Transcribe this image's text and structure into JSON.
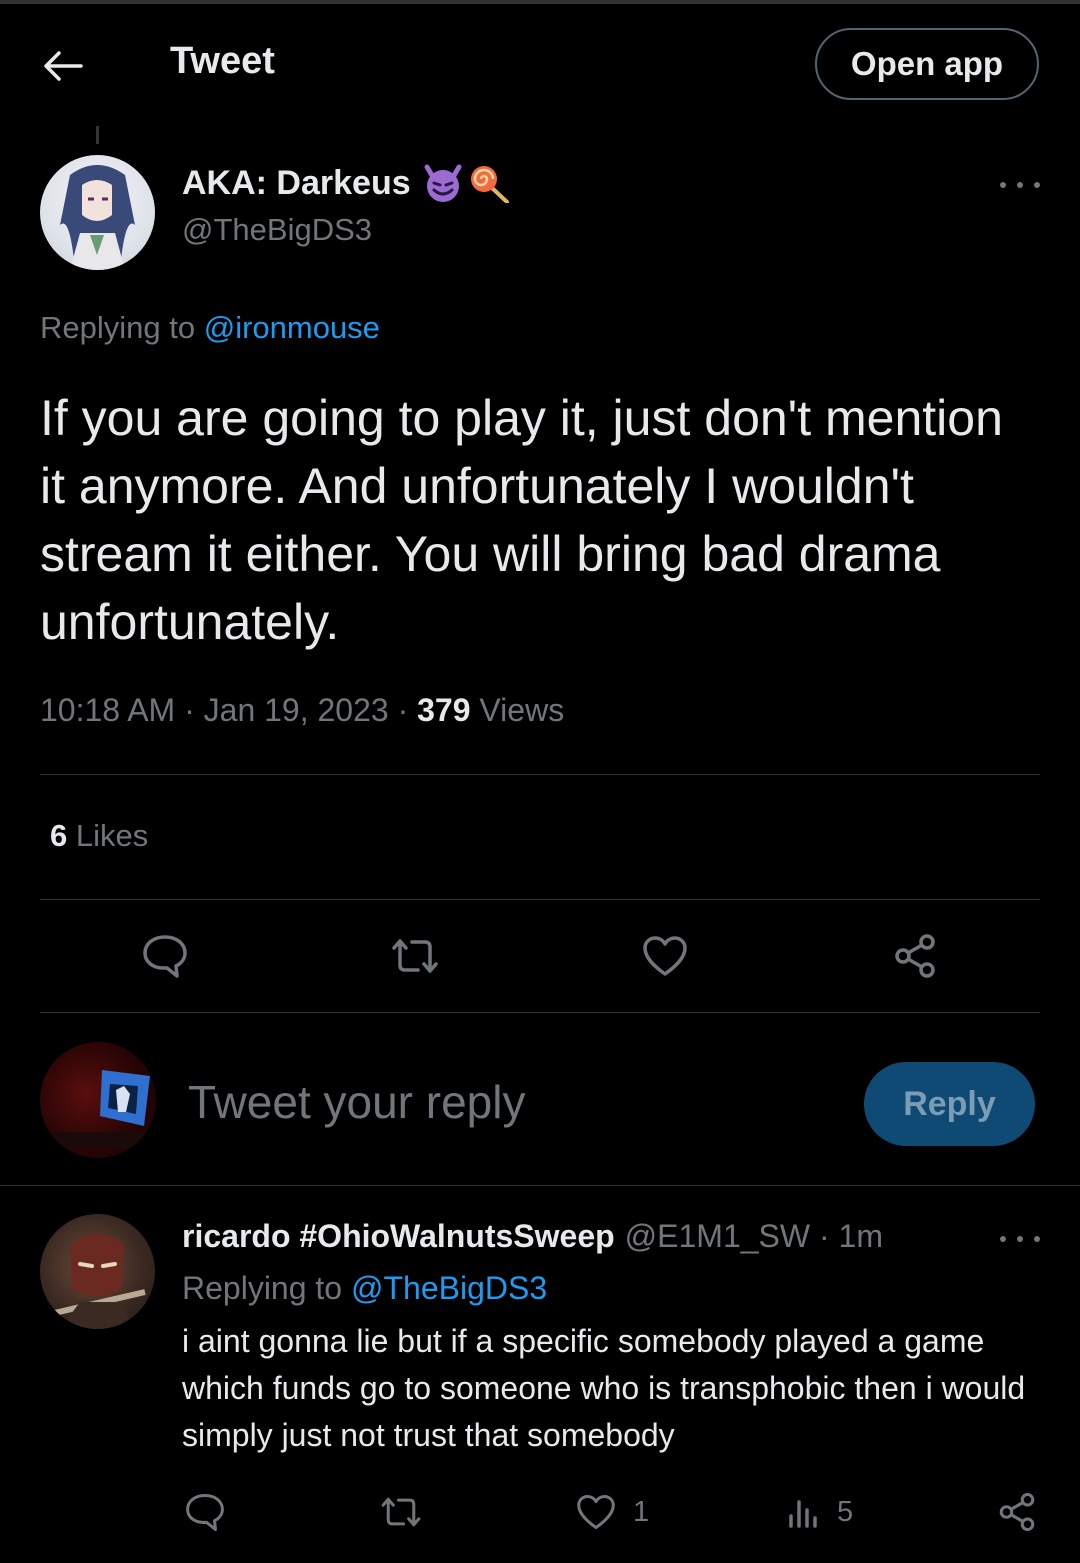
{
  "header": {
    "title": "Tweet",
    "open_app_label": "Open app"
  },
  "tweet": {
    "author_name": "AKA: Darkeus",
    "author_emoji": [
      "😈",
      "🍭"
    ],
    "author_handle": "@TheBigDS3",
    "replying_prefix": "Replying to",
    "replying_to": "@ironmouse",
    "text": "If you are going to play it, just don't mention it anymore. And unfortunately I wouldn't stream it either. You will bring bad drama unfortunately.",
    "time": "10:18 AM",
    "date": "Jan 19, 2023",
    "views_count": "379",
    "views_label": "Views",
    "likes_count": "6",
    "likes_label": "Likes",
    "actions": [
      "reply",
      "retweet",
      "like",
      "share"
    ]
  },
  "composer": {
    "placeholder": "Tweet your reply",
    "reply_label": "Reply"
  },
  "replies": [
    {
      "name": "ricardo #OhioWalnutsSweep",
      "handle": "@E1M1_SW",
      "time": "1m",
      "replying_prefix": "Replying to",
      "replying_to": "@TheBigDS3",
      "text": "i aint gonna lie but if a specific somebody played a game which funds go to someone who is transphobic then i would simply just not trust that somebody",
      "like_count": "1",
      "views_count": "5"
    }
  ],
  "colors": {
    "background": "#000000",
    "text_primary": "#e7e9ea",
    "text_secondary": "#71767b",
    "link": "#1d9bf0",
    "reply_button_bg": "#0e4a74",
    "divider": "#2f3336"
  }
}
